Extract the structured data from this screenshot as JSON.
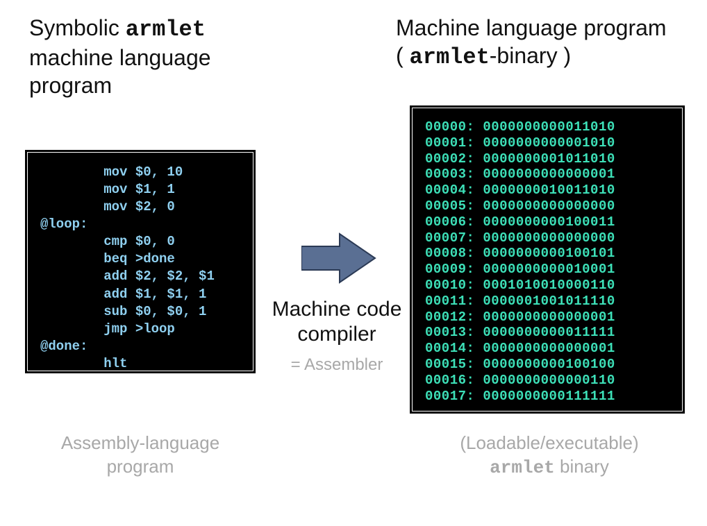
{
  "titles": {
    "left_pre": "Symbolic ",
    "left_code": "armlet",
    "left_post": " machine language program",
    "right_pre": "Machine language program",
    "right_paren_open": "( ",
    "right_code": "armlet",
    "right_paren_close": "-binary )"
  },
  "arrow": {
    "label_line1": "Machine code",
    "label_line2": "compiler",
    "sublabel": "= Assembler"
  },
  "captions": {
    "left_line1": "Assembly-language",
    "left_line2": "program",
    "right_line1": "(Loadable/executable)",
    "right_code": "armlet",
    "right_line2_post": " binary"
  },
  "assembly": {
    "indent": "        ",
    "lines": [
      {
        "label": "",
        "instr": "mov $0, 10"
      },
      {
        "label": "",
        "instr": "mov $1, 1"
      },
      {
        "label": "",
        "instr": "mov $2, 0"
      },
      {
        "label": "@loop:",
        "instr": ""
      },
      {
        "label": "",
        "instr": "cmp $0, 0"
      },
      {
        "label": "",
        "instr": "beq >done"
      },
      {
        "label": "",
        "instr": "add $2, $2, $1"
      },
      {
        "label": "",
        "instr": "add $1, $1, 1"
      },
      {
        "label": "",
        "instr": "sub $0, $0, 1"
      },
      {
        "label": "",
        "instr": "jmp >loop"
      },
      {
        "label": "@done:",
        "instr": ""
      },
      {
        "label": "",
        "instr": "hlt"
      }
    ]
  },
  "binary": {
    "rows": [
      {
        "addr": "00000",
        "bits": "0000000000011010"
      },
      {
        "addr": "00001",
        "bits": "0000000000001010"
      },
      {
        "addr": "00002",
        "bits": "0000000001011010"
      },
      {
        "addr": "00003",
        "bits": "0000000000000001"
      },
      {
        "addr": "00004",
        "bits": "0000000010011010"
      },
      {
        "addr": "00005",
        "bits": "0000000000000000"
      },
      {
        "addr": "00006",
        "bits": "0000000000100011"
      },
      {
        "addr": "00007",
        "bits": "0000000000000000"
      },
      {
        "addr": "00008",
        "bits": "0000000000100101"
      },
      {
        "addr": "00009",
        "bits": "0000000000010001"
      },
      {
        "addr": "00010",
        "bits": "0001010010000110"
      },
      {
        "addr": "00011",
        "bits": "0000001001011110"
      },
      {
        "addr": "00012",
        "bits": "0000000000000001"
      },
      {
        "addr": "00013",
        "bits": "0000000000011111"
      },
      {
        "addr": "00014",
        "bits": "0000000000000001"
      },
      {
        "addr": "00015",
        "bits": "0000000000100100"
      },
      {
        "addr": "00016",
        "bits": "0000000000000110"
      },
      {
        "addr": "00017",
        "bits": "0000000000111111"
      }
    ]
  }
}
